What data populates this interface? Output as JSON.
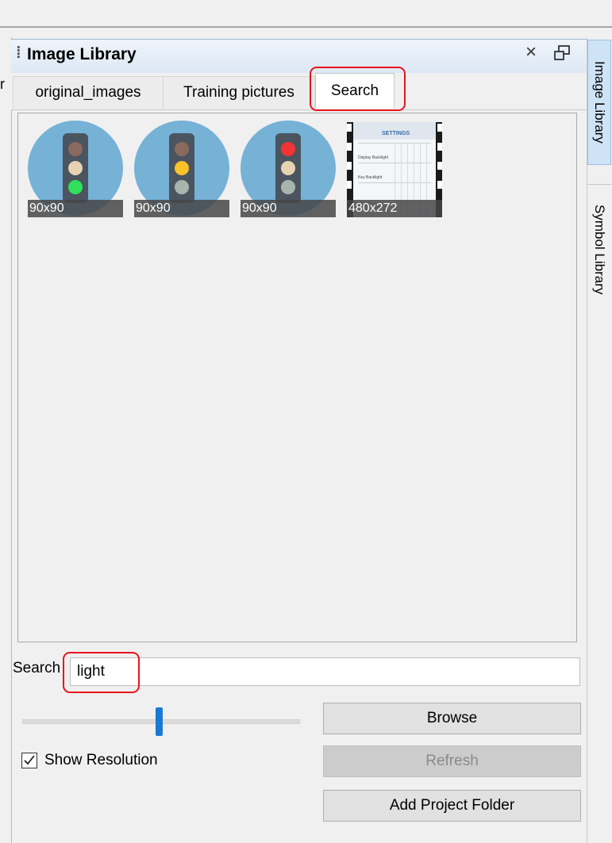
{
  "window": {
    "title": "Image Library",
    "close_glyph": "×"
  },
  "tabs": [
    {
      "label": "original_images",
      "active": false
    },
    {
      "label": "Training pictures",
      "active": false
    },
    {
      "label": "Search",
      "active": true
    }
  ],
  "images": [
    {
      "resolution": "90x90",
      "icon": "traffic-light-green-icon"
    },
    {
      "resolution": "90x90",
      "icon": "traffic-light-yellow-icon"
    },
    {
      "resolution": "90x90",
      "icon": "traffic-light-red-icon"
    },
    {
      "resolution": "480x272",
      "icon": "settings-screen-thumbnail",
      "thumb_title": "SETTINGS",
      "thumb_line1": "Display Backlight",
      "thumb_line2": "Key Backlight"
    }
  ],
  "search": {
    "label": "Search",
    "value": "light"
  },
  "slider": {
    "value_fraction": 0.49
  },
  "show_resolution": {
    "label": "Show Resolution",
    "checked": true,
    "check_glyph": "✓"
  },
  "buttons": {
    "browse": "Browse",
    "refresh": "Refresh",
    "add_project_folder": "Add Project Folder"
  },
  "side_tabs": [
    {
      "label": "Image Library",
      "active": true
    },
    {
      "label": "Symbol Library",
      "active": false
    }
  ],
  "left_stub": "r",
  "colors": {
    "accent": "#1979d4",
    "highlight": "#e8141c",
    "light_circle": "#76b1d6",
    "housing": "#4a5560"
  }
}
